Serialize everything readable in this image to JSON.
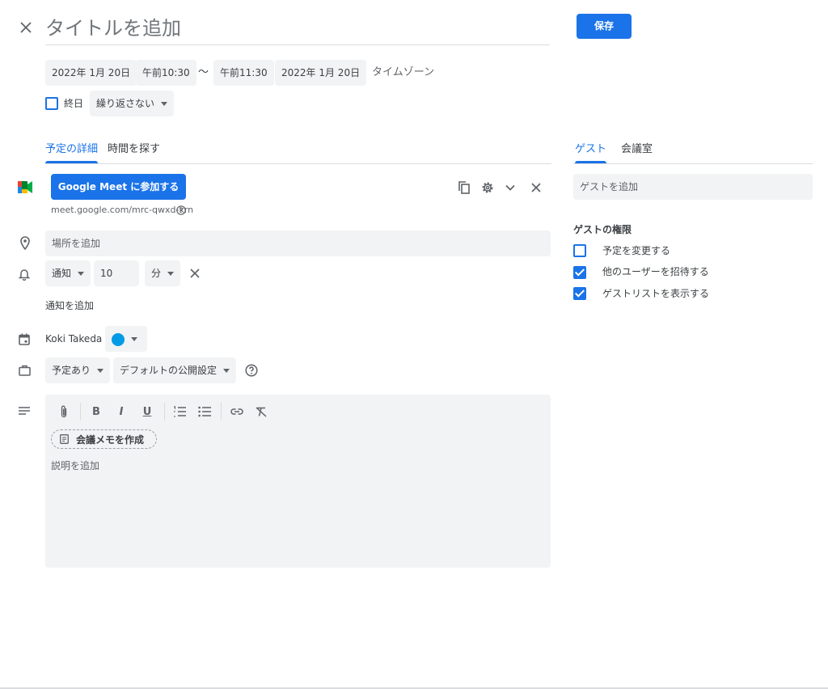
{
  "header": {
    "title_placeholder": "タイトルを追加",
    "save_label": "保存"
  },
  "datetime": {
    "start_date": "2022年 1月 20日",
    "start_time": "午前10:30",
    "separator": "〜",
    "end_time": "午前11:30",
    "end_date": "2022年 1月 20日",
    "timezone_label": "タイムゾーン"
  },
  "options": {
    "all_day_label": "終日",
    "all_day_checked": false,
    "repeat_label": "繰り返さない"
  },
  "tabs": {
    "details": "予定の詳細",
    "find_time": "時間を探す",
    "guests": "ゲスト",
    "rooms": "会議室"
  },
  "meet": {
    "join_label": "Google Meet に参加する",
    "url": "meet.google.com/mrc-qwxd-krn"
  },
  "location": {
    "placeholder": "場所を追加"
  },
  "notification": {
    "type": "通知",
    "value": "10",
    "unit": "分",
    "add_label": "通知を追加"
  },
  "calendar": {
    "owner": "Koki Takeda",
    "color": "#039be5"
  },
  "availability": {
    "busy": "予定あり",
    "visibility": "デフォルトの公開設定"
  },
  "description": {
    "notes_label": "会議メモを作成",
    "placeholder": "説明を追加"
  },
  "guests": {
    "placeholder": "ゲストを追加",
    "permissions_title": "ゲストの権限",
    "permissions": [
      {
        "label": "予定を変更する",
        "checked": false
      },
      {
        "label": "他のユーザーを招待する",
        "checked": true
      },
      {
        "label": "ゲストリストを表示する",
        "checked": true
      }
    ]
  },
  "colors": {
    "accent": "#1a73e8",
    "field_bg": "#f1f3f4"
  }
}
